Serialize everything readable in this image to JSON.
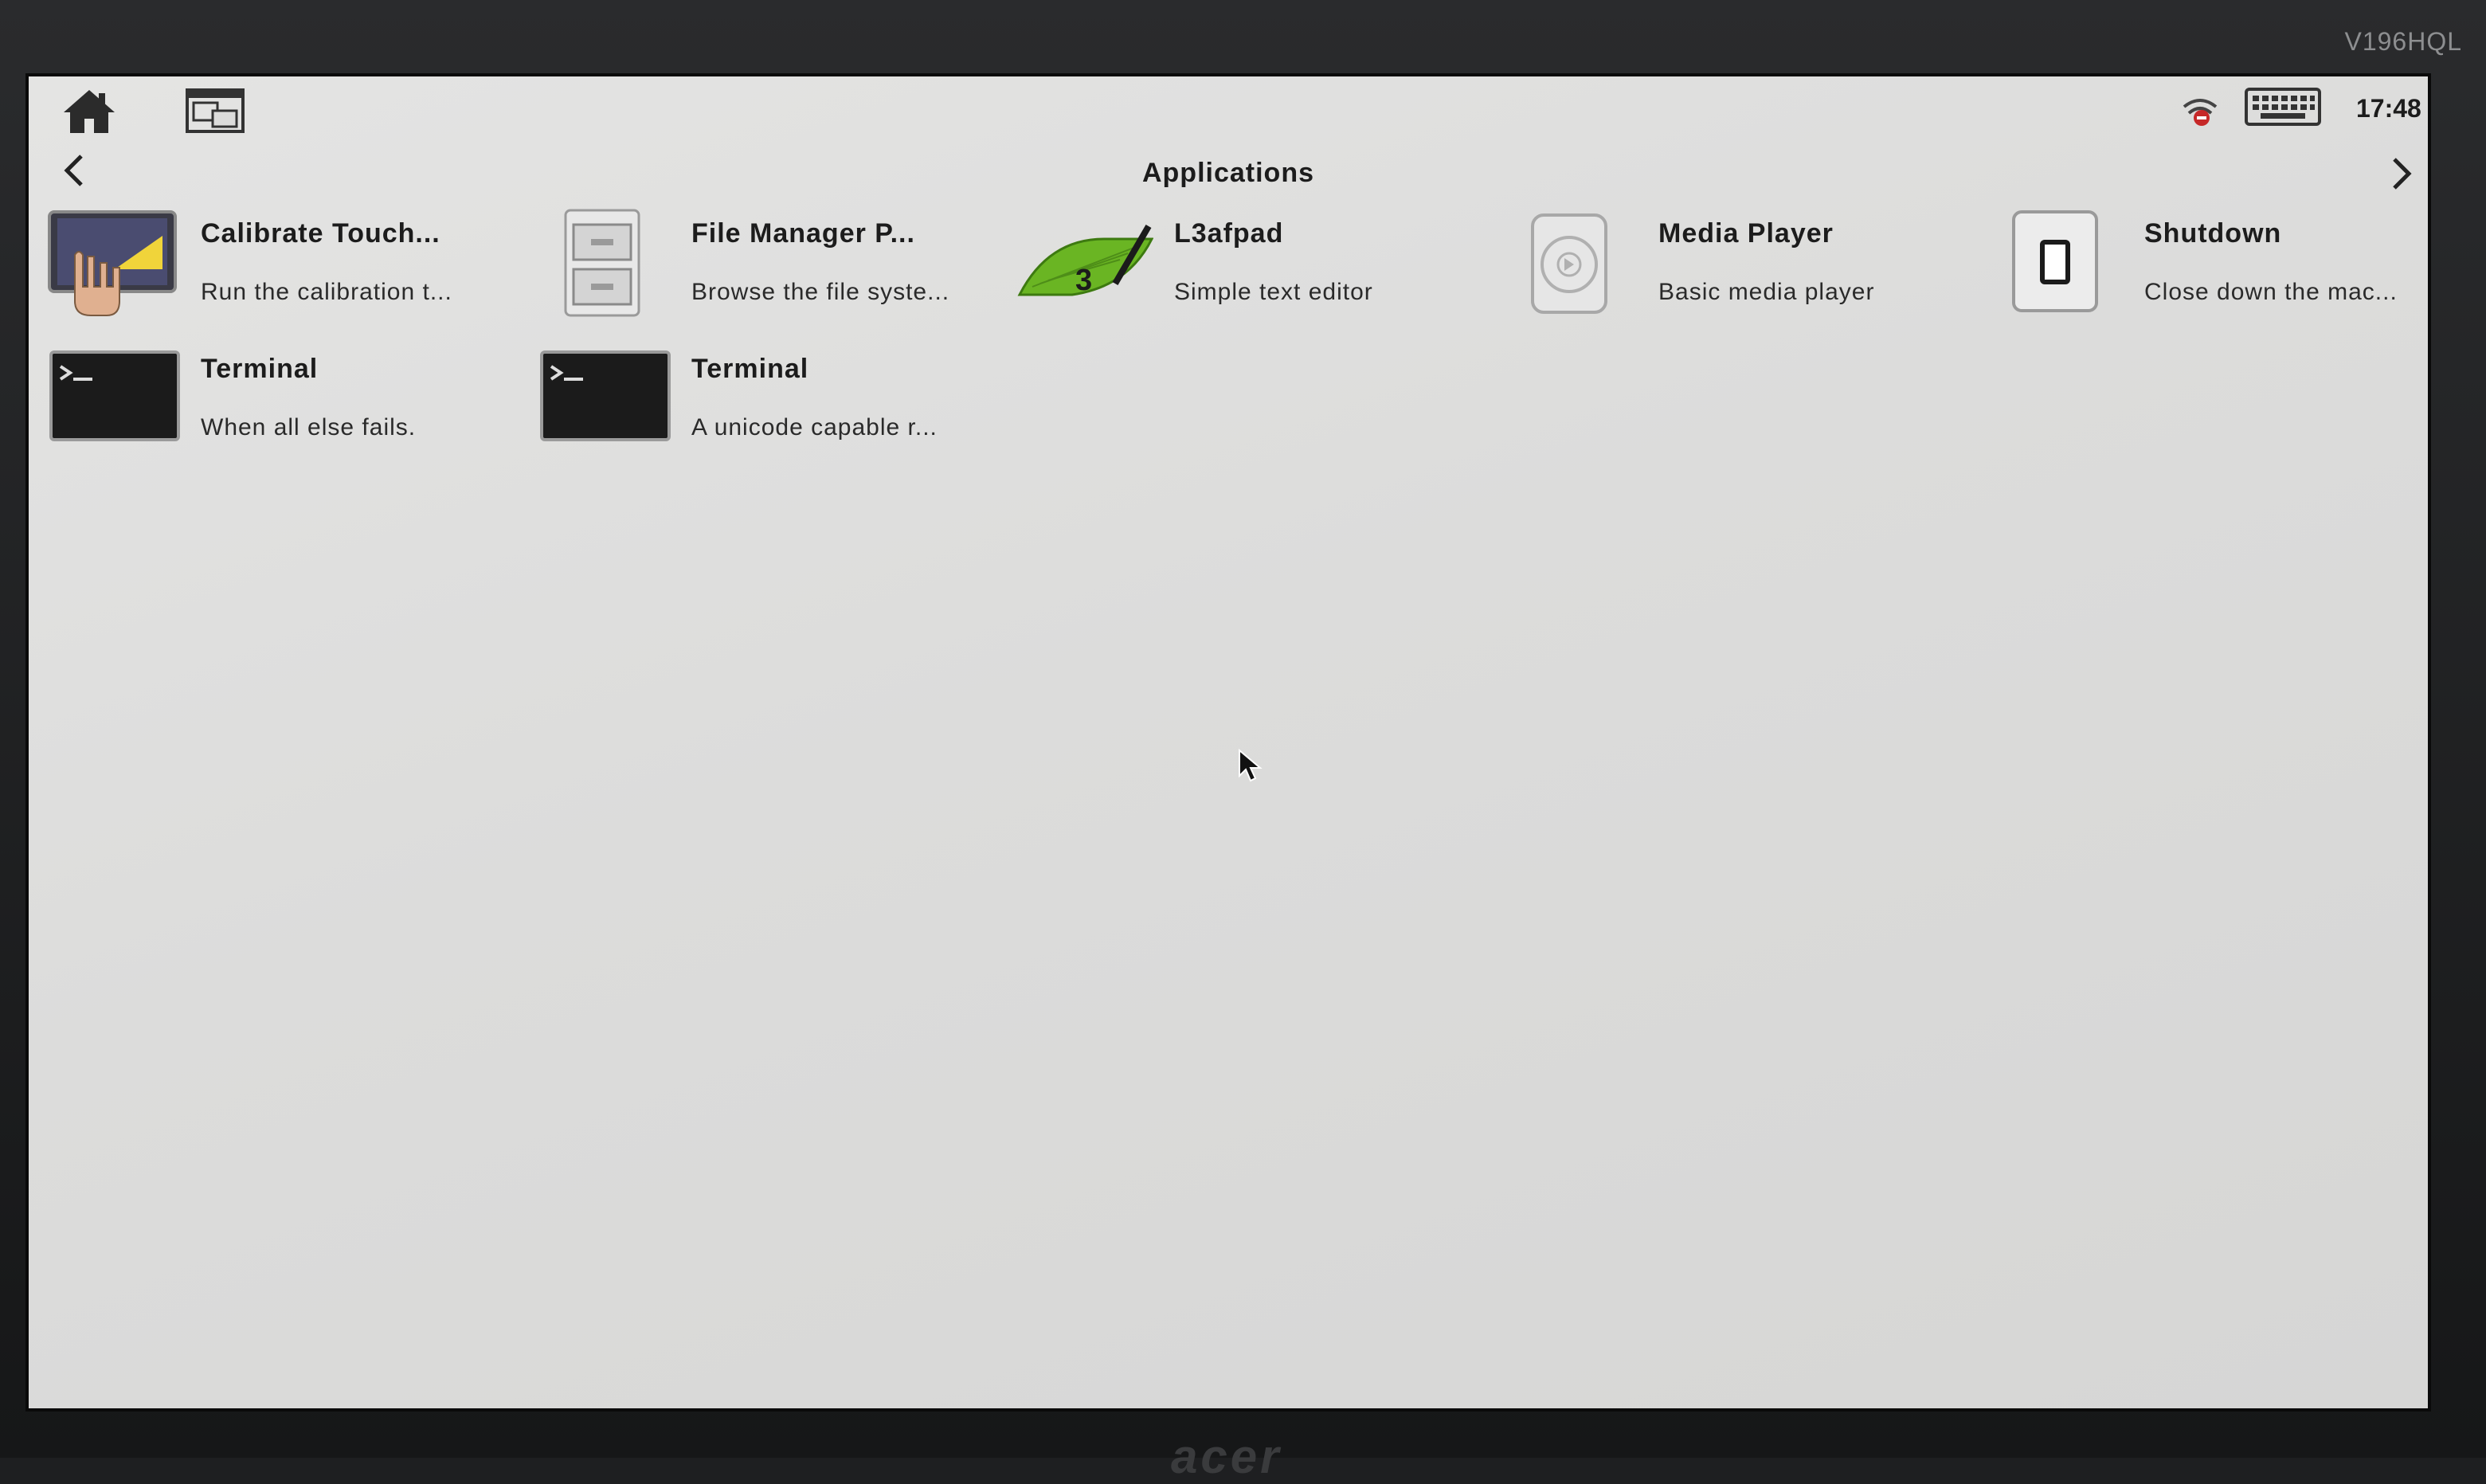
{
  "monitor": {
    "model": "V196HQL",
    "brand": "acer"
  },
  "topbar": {
    "home_icon": "home-icon",
    "windows_icon": "window-switcher-icon",
    "tray": {
      "network_icon": "network-status-icon",
      "keyboard_icon": "keyboard-icon"
    },
    "clock": "17:48"
  },
  "page": {
    "title": "Applications",
    "prev_icon": "chevron-left-icon",
    "next_icon": "chevron-right-icon"
  },
  "apps": [
    {
      "name": "Calibrate Touch...",
      "description": "Run the calibration t...",
      "icon": "calibrate-touch-icon"
    },
    {
      "name": "File Manager P...",
      "description": "Browse the file syste...",
      "icon": "file-cabinet-icon"
    },
    {
      "name": "L3afpad",
      "description": "Simple text editor",
      "icon": "l3afpad-icon"
    },
    {
      "name": "Media Player",
      "description": "Basic media player",
      "icon": "media-player-icon"
    },
    {
      "name": "Shutdown",
      "description": "Close down the mac...",
      "icon": "shutdown-icon"
    },
    {
      "name": "Terminal",
      "description": "When all else fails.",
      "icon": "terminal-icon"
    },
    {
      "name": "Terminal",
      "description": "A unicode capable r...",
      "icon": "terminal-icon"
    }
  ],
  "colors": {
    "screen_bg": "#dcdcdb",
    "text": "#1c1c1c",
    "l3afpad_green": "#6ab523",
    "terminal_bg": "#1b1b1b"
  }
}
